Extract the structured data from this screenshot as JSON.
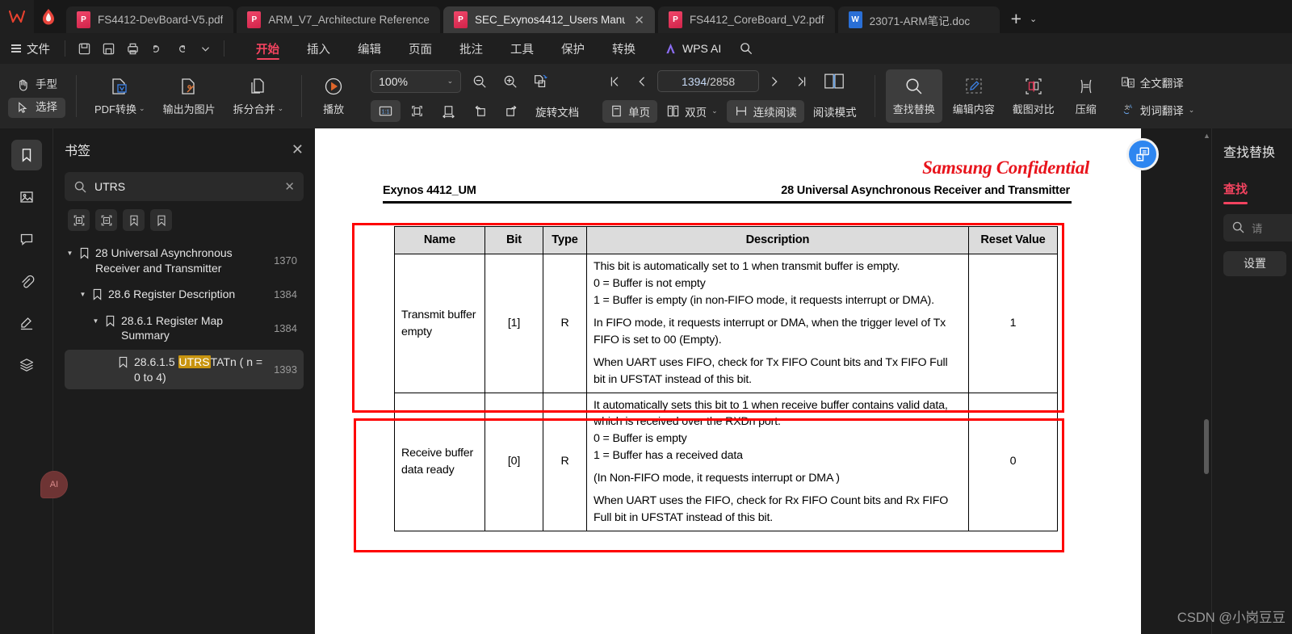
{
  "window": {
    "app_logo": "wps-logo-icon",
    "tabs": [
      {
        "label": "FS4412-DevBoard-V5.pdf",
        "type": "pdf",
        "active": false,
        "closable": false
      },
      {
        "label": "ARM_V7_Architecture Reference",
        "type": "pdf",
        "active": false,
        "closable": false
      },
      {
        "label": "SEC_Exynos4412_Users Manu",
        "type": "pdf",
        "active": true,
        "closable": true
      },
      {
        "label": "FS4412_CoreBoard_V2.pdf",
        "type": "pdf",
        "active": false,
        "closable": false
      },
      {
        "label": "23071-ARM笔记.doc",
        "type": "doc",
        "active": false,
        "closable": false
      }
    ],
    "new_tab_label": "+",
    "tab_overflow_label": "⌄"
  },
  "menubar": {
    "file_label": "文件",
    "quick_icons": [
      "save-icon",
      "save-as-icon",
      "print-icon",
      "undo-icon",
      "redo-icon",
      "more-chevron-icon"
    ],
    "items": [
      {
        "label": "开始",
        "active": true
      },
      {
        "label": "插入",
        "active": false
      },
      {
        "label": "编辑",
        "active": false
      },
      {
        "label": "页面",
        "active": false
      },
      {
        "label": "批注",
        "active": false
      },
      {
        "label": "工具",
        "active": false
      },
      {
        "label": "保护",
        "active": false
      },
      {
        "label": "转换",
        "active": false
      }
    ],
    "wps_ai_label": "WPS AI",
    "search_icon": "search-icon"
  },
  "toolbar": {
    "hand_label": "手型",
    "select_label": "选择",
    "pdf_convert_label": "PDF转换",
    "export_image_label": "输出为图片",
    "split_merge_label": "拆分合并",
    "play_label": "播放",
    "zoom_value": "100%",
    "zoom_out_icon": "zoom-out-icon",
    "zoom_in_icon": "zoom-in-icon",
    "actual_size_label": "1:1",
    "fit_page_icon": "fit-page-icon",
    "fit_width_icon": "fit-width-icon",
    "rotate_left_icon": "rotate-left-icon",
    "rotate_right_icon": "rotate-right-icon",
    "rotate_doc_label": "旋转文档",
    "page_current": "1394",
    "page_sep": "/",
    "page_total": "2858",
    "first_page_icon": "first-page-icon",
    "prev_page_icon": "prev-page-icon",
    "next_page_icon": "next-page-icon",
    "last_page_icon": "last-page-icon",
    "single_page_label": "单页",
    "double_page_label": "双页",
    "continuous_read_label": "连续阅读",
    "read_mode_label": "阅读模式",
    "find_replace_label": "查找替换",
    "edit_content_label": "编辑内容",
    "screenshot_compare_label": "截图对比",
    "compress_label": "压缩",
    "full_translate_label": "全文翻译",
    "word_translate_label": "划词翻译"
  },
  "rail": {
    "items": [
      {
        "name": "bookmark-icon",
        "active": true
      },
      {
        "name": "thumbnail-icon",
        "active": false
      },
      {
        "name": "comment-icon",
        "active": false
      },
      {
        "name": "attachment-icon",
        "active": false
      },
      {
        "name": "signature-icon",
        "active": false
      },
      {
        "name": "layers-icon",
        "active": false
      }
    ],
    "ai_badge": "AI"
  },
  "bookmark_panel": {
    "title": "书签",
    "close_icon": "close-icon",
    "search_value": "UTRS",
    "search_placeholder": "",
    "search_icon": "search-icon",
    "clear_icon": "clear-icon",
    "tools": [
      "expand-all-icon",
      "collapse-all-icon",
      "add-bookmark-icon",
      "remove-bookmark-icon"
    ],
    "items": [
      {
        "indent": 0,
        "expanded": true,
        "text": "28 Universal Asynchronous Receiver and Transmitter",
        "page": "1370",
        "selected": false,
        "highlight": ""
      },
      {
        "indent": 1,
        "expanded": true,
        "text": "28.6 Register Description",
        "page": "1384",
        "selected": false,
        "highlight": ""
      },
      {
        "indent": 2,
        "expanded": true,
        "text": "28.6.1 Register Map Summary",
        "page": "1384",
        "selected": false,
        "highlight": ""
      },
      {
        "indent": 3,
        "expanded": false,
        "text": "28.6.1.5 UTRSTATn ( n = 0 to 4)",
        "page": "1393",
        "selected": true,
        "highlight": "UTRS"
      }
    ]
  },
  "document": {
    "confidential": "Samsung Confidential",
    "header_left": "Exynos 4412_UM",
    "header_right": "28 Universal Asynchronous Receiver and Transmitter",
    "float_ai_icon": "ai-assistant-icon",
    "table": {
      "headers": [
        "Name",
        "Bit",
        "Type",
        "Description",
        "Reset Value"
      ],
      "rows": [
        {
          "name": "Transmit buffer empty",
          "bit": "[1]",
          "type": "R",
          "description": [
            "This bit is automatically set to 1 when transmit buffer is empty.",
            "0 = Buffer is not empty",
            "1 = Buffer is empty (in non-FIFO mode, it requests interrupt or DMA).",
            "In FIFO mode, it requests interrupt or DMA, when the trigger level of Tx FIFO is set to 00 (Empty).",
            "When UART uses FIFO, check for Tx FIFO Count bits and Tx FIFO Full bit in UFSTAT instead of this bit."
          ],
          "reset": "1",
          "annotated": true
        },
        {
          "name": "Receive buffer data ready",
          "bit": "[0]",
          "type": "R",
          "description": [
            "It automatically sets this bit to 1 when receive buffer contains valid data, which is received over the RXDn port.",
            "0 = Buffer is empty",
            "1 = Buffer has a received data",
            "(In Non-FIFO mode, it requests interrupt or DMA )",
            "When UART uses the FIFO, check for Rx FIFO Count bits and Rx FIFO Full bit in UFSTAT instead of this bit."
          ],
          "reset": "0",
          "annotated": true
        }
      ]
    }
  },
  "find_panel": {
    "title": "查找替换",
    "tab_label": "查找",
    "search_placeholder": "请",
    "search_icon": "search-icon",
    "settings_label": "设置"
  },
  "watermark": "CSDN @小岗豆豆",
  "colors": {
    "accent_red": "#f2435f",
    "annotation_red": "#fe0000",
    "confidential_red": "#e8141c",
    "highlight_yellow": "#c8940f",
    "page_number_blue": "#c6d9f5",
    "ai_blue": "#2e86f0"
  }
}
